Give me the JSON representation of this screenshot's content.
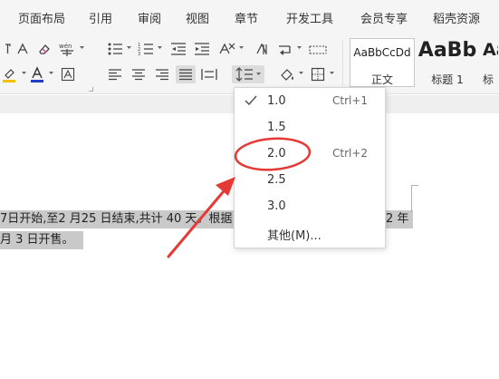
{
  "menu": [
    "页面布局",
    "引用",
    "审阅",
    "视图",
    "章节",
    "开发工具",
    "会员专享",
    "稻壳资源"
  ],
  "styles": [
    {
      "sample": "AaBbCcDd",
      "label": "正文"
    },
    {
      "sample": "AaBb",
      "label": "标题 1"
    },
    {
      "sample": "Aa",
      "label": "标"
    }
  ],
  "document": {
    "line1": "7日开始,至2 月25  日结束,共计 40 天。根据",
    "line1_tail": "2  年",
    "line2": "月 3  日开售。"
  },
  "line_spacing_menu": {
    "items": [
      {
        "label": "1.0",
        "shortcut": "Ctrl+1",
        "checked": true
      },
      {
        "label": "1.5",
        "shortcut": ""
      },
      {
        "label": "2.0",
        "shortcut": "Ctrl+2"
      },
      {
        "label": "2.5",
        "shortcut": ""
      },
      {
        "label": "3.0",
        "shortcut": ""
      },
      {
        "label": "其他(M)...",
        "shortcut": ""
      }
    ]
  },
  "colors": {
    "annotation": "#e53935",
    "font_color_bar": "#1e3ec8",
    "highlight_bar": "#f2c200",
    "check": "#555555"
  },
  "icons": [
    "clear-format-icon",
    "phonetic-guide-icon",
    "bullet-list-icon",
    "numbered-list-icon",
    "decrease-indent-icon",
    "increase-indent-icon",
    "chinese-layout-icon",
    "show-marks-icon",
    "sort-icon",
    "table-borders-icon",
    "highlight-icon",
    "font-color-icon",
    "char-border-icon",
    "align-left-icon",
    "align-center-icon",
    "align-right-icon",
    "justify-icon",
    "distributed-icon",
    "line-spacing-icon",
    "shading-icon",
    "borders-icon"
  ]
}
